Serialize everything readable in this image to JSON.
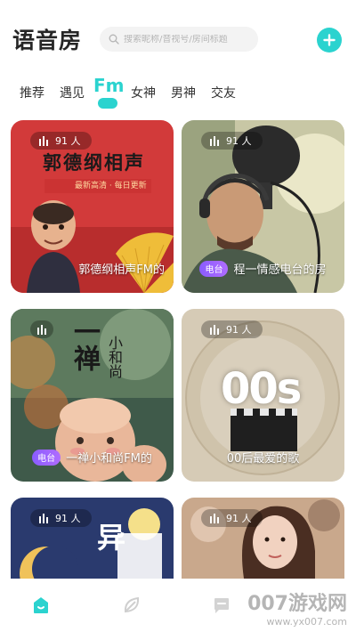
{
  "header": {
    "title": "语音房",
    "search_placeholder": "搜索昵称/音视号/房间标题"
  },
  "tabs": [
    {
      "label": "推荐",
      "active": false
    },
    {
      "label": "遇见",
      "active": false
    },
    {
      "label": "Fm",
      "active": true
    },
    {
      "label": "女神",
      "active": false
    },
    {
      "label": "男神",
      "active": false
    },
    {
      "label": "交友",
      "active": false
    }
  ],
  "cards": [
    {
      "count": "91 人",
      "badge": "",
      "title": "郭德纲相声FM的",
      "art_text": "郭德纲相声",
      "art_sub": "最新高清 · 每日更新"
    },
    {
      "count": "91 人",
      "badge": "电台",
      "title": "程一情感电台的房"
    },
    {
      "count": "",
      "badge": "电台",
      "title": "一禅小和尚FM的",
      "art_text": "一禅",
      "art_text2": "小和尚"
    },
    {
      "count": "91 人",
      "badge": "",
      "title": "00后最爱的歌",
      "art_text": "00s"
    },
    {
      "count": "91 人",
      "badge": "",
      "title": "",
      "art_text": "异"
    },
    {
      "count": "91 人",
      "badge": "",
      "title": ""
    }
  ],
  "watermark": {
    "main": "007游戏网",
    "sub": "www.yx007.com"
  },
  "colors": {
    "accent": "#2bd3cf",
    "badge": "#9b63ff"
  },
  "icons": {
    "search": "search-icon",
    "add": "plus-icon",
    "home": "home-icon",
    "discover": "leaf-icon",
    "messages": "chat-icon"
  }
}
